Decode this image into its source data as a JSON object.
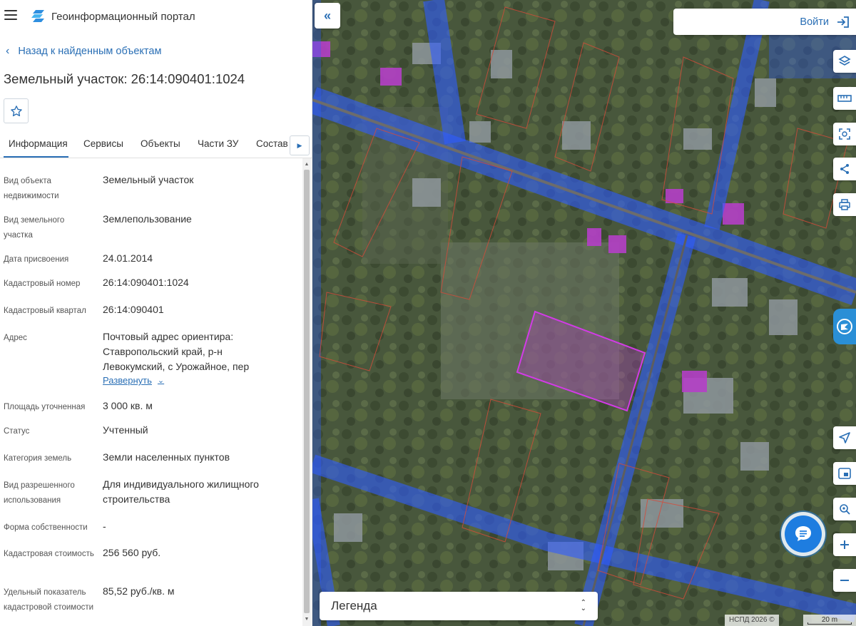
{
  "header": {
    "app_title": "Геоинформационный портал"
  },
  "navigation": {
    "back_label": "Назад к найденным объектам"
  },
  "object": {
    "title": "Земельный участок: 26:14:090401:1024"
  },
  "tabs": [
    {
      "label": "Информация",
      "active": true
    },
    {
      "label": "Сервисы"
    },
    {
      "label": "Объекты"
    },
    {
      "label": "Части ЗУ"
    },
    {
      "label": "Состав"
    }
  ],
  "fields": [
    {
      "label": "Вид объекта недвижимости",
      "value": "Земельный участок"
    },
    {
      "label": "Вид земельного участка",
      "value": "Землепользование"
    },
    {
      "label": "Дата присвоения",
      "value": "24.01.2014"
    },
    {
      "label": "Кадастровый номер",
      "value": "26:14:090401:1024"
    },
    {
      "label": "Кадастровый квартал",
      "value": "26:14:090401"
    },
    {
      "label": "Адрес",
      "value": "Почтовый адрес ориентира: Ставропольский край, р-н Левокумский, с Урожайное, пер"
    },
    {
      "label": "Площадь уточненная",
      "value": "3 000 кв. м"
    },
    {
      "label": "Статус",
      "value": "Учтенный"
    },
    {
      "label": "Категория земель",
      "value": "Земли населенных пунктов"
    },
    {
      "label": "Вид разрешенного использования",
      "value": "Для индивидуального жилищного строительства"
    },
    {
      "label": "Форма собственности",
      "value": "-"
    },
    {
      "label": "Кадастровая стоимость",
      "value": "256 560 руб."
    },
    {
      "label": "Удельный показатель кадастровой стоимости",
      "value": "85,52 руб./кв. м"
    }
  ],
  "address_expand_label": "Развернуть",
  "map": {
    "login_label": "Войти",
    "legend_label": "Легенда",
    "attribution": "НСПД 2026 ©",
    "scale_label": "20 m",
    "tools": [
      "layers-icon",
      "ruler-icon",
      "select-area-icon",
      "share-icon",
      "print-icon",
      "locate-icon",
      "map-view-icon",
      "geo-search-icon",
      "zoom-in-icon",
      "zoom-out-icon"
    ],
    "colors": {
      "accent": "#2a6fb5",
      "highlight": "#c23ad6",
      "zone_blue": "#2f5cff"
    }
  }
}
